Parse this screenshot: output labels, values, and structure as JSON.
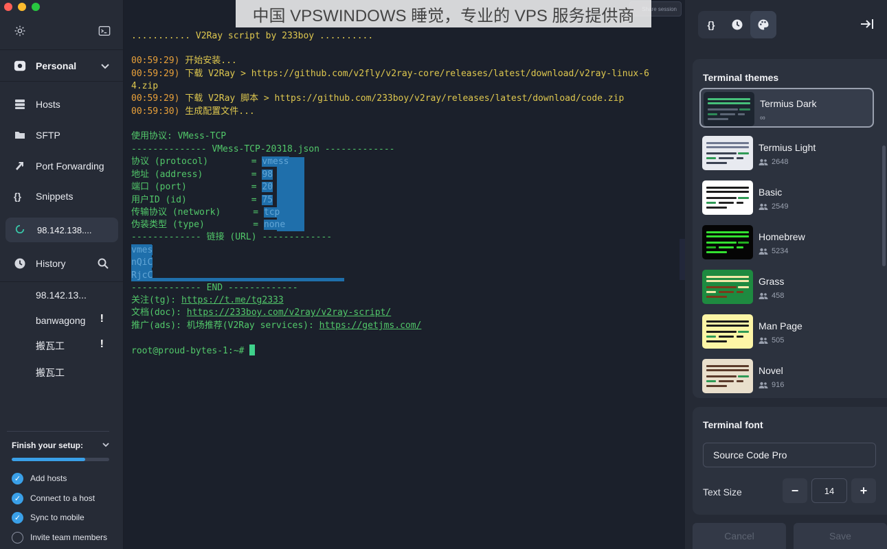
{
  "watermark": "中国 VPSWINDOWS 睡觉，专业的 VPS 服务提供商",
  "share_button": "Share session",
  "sidebar": {
    "vault": "Personal",
    "nav": [
      {
        "label": "Hosts",
        "icon": "hosts-icon"
      },
      {
        "label": "SFTP",
        "icon": "folder-icon"
      },
      {
        "label": "Port Forwarding",
        "icon": "port-forwarding-icon"
      },
      {
        "label": "Snippets",
        "icon": "braces-icon"
      }
    ],
    "active_host": "98.142.138....",
    "history_label": "History",
    "history_items": [
      {
        "label": "98.142.13...",
        "warn": ""
      },
      {
        "label": "banwagong",
        "warn": "!"
      },
      {
        "label": "搬瓦工",
        "warn": "!"
      },
      {
        "label": "搬瓦工",
        "warn": ""
      }
    ],
    "setup": {
      "title": "Finish your setup:",
      "progress": 0.75,
      "steps": [
        {
          "label": "Add hosts",
          "done": true
        },
        {
          "label": "Connect to a host",
          "done": true
        },
        {
          "label": "Sync to mobile",
          "done": true
        },
        {
          "label": "Invite team members",
          "done": false
        }
      ]
    }
  },
  "terminal": {
    "banner": "........... V2Ray script by 233boy ..........",
    "log": [
      {
        "time": "00:59:29)",
        "msg": " 开始安装..."
      },
      {
        "time": "00:59:29)",
        "msg": " 下载 V2Ray > https://github.com/v2fly/v2ray-core/releases/latest/download/v2ray-linux-6"
      },
      {
        "time": "",
        "msg": "4.zip"
      },
      {
        "time": "00:59:29)",
        "msg": " 下载 V2Ray 脚本 > https://github.com/233boy/v2ray/releases/latest/download/code.zip"
      },
      {
        "time": "00:59:30)",
        "msg": " 生成配置文件..."
      }
    ],
    "protocol_line": "使用协议: VMess-TCP",
    "header_line": "-------------- VMess-TCP-20318.json -------------",
    "config": [
      {
        "key": "协议 (protocol)        = ",
        "val": "vmess"
      },
      {
        "key": "地址 (address)         = ",
        "val": "98"
      },
      {
        "key": "端口 (port)            = ",
        "val": "20"
      },
      {
        "key": "用户ID (id)            = ",
        "val": "75"
      },
      {
        "key": "传输协议 (network)      = ",
        "val": "tcp"
      },
      {
        "key": "伪装类型 (type)         = ",
        "val": "none"
      }
    ],
    "url_header": "------------- 链接 (URL) -------------",
    "url_lines": [
      "vmes",
      "nQiC",
      "RjcC"
    ],
    "end_line": "------------- END -------------",
    "links": [
      {
        "key": "关注(tg): ",
        "url": "https://t.me/tg2333"
      },
      {
        "key": "文档(doc): ",
        "url": "https://233boy.com/v2ray/v2ray-script/"
      },
      {
        "key": "推广(ads): 机场推荐(V2Ray services): ",
        "url": "https://getjms.com/"
      }
    ],
    "prompt": "root@proud-bytes-1:~# "
  },
  "panel": {
    "tabs": [
      {
        "label": "{}",
        "name": "tab-snippets"
      },
      {
        "label": "",
        "name": "tab-history"
      },
      {
        "label": "",
        "name": "tab-themes"
      }
    ],
    "themes_title": "Terminal themes",
    "themes": [
      {
        "name": "Termius Dark",
        "count": "∞",
        "bg": "#1d2530",
        "bar": "#46c07a",
        "bar2": "#2e8a58",
        "line": "#5b6575"
      },
      {
        "name": "Termius Light",
        "count": "2648",
        "bg": "#e8eaf0",
        "bar": "#6f7890",
        "bar2": "#2f9a55",
        "line": "#3b4252"
      },
      {
        "name": "Basic",
        "count": "2549",
        "bg": "#ffffff",
        "bar": "#1a1a1a",
        "bar2": "#2f9a55",
        "line": "#222222"
      },
      {
        "name": "Homebrew",
        "count": "5234",
        "bg": "#050505",
        "bar": "#33e030",
        "bar2": "#22b020",
        "line": "#33e030"
      },
      {
        "name": "Grass",
        "count": "458",
        "bg": "#1e8a40",
        "bar": "#f4e8a8",
        "bar2": "#f4e8a8",
        "line": "#7a3a1a"
      },
      {
        "name": "Man Page",
        "count": "505",
        "bg": "#fdf5a6",
        "bar": "#1a1a1a",
        "bar2": "#2f9a55",
        "line": "#1a1a1a"
      },
      {
        "name": "Novel",
        "count": "916",
        "bg": "#e9dfcc",
        "bar": "#5b3a2a",
        "bar2": "#2f9a55",
        "line": "#5b3a2a"
      }
    ],
    "font_title": "Terminal font",
    "font_value": "Source Code Pro",
    "text_size_label": "Text Size",
    "text_size_minus": "−",
    "text_size_value": "14",
    "text_size_plus": "+",
    "cancel": "Cancel",
    "save": "Save"
  }
}
